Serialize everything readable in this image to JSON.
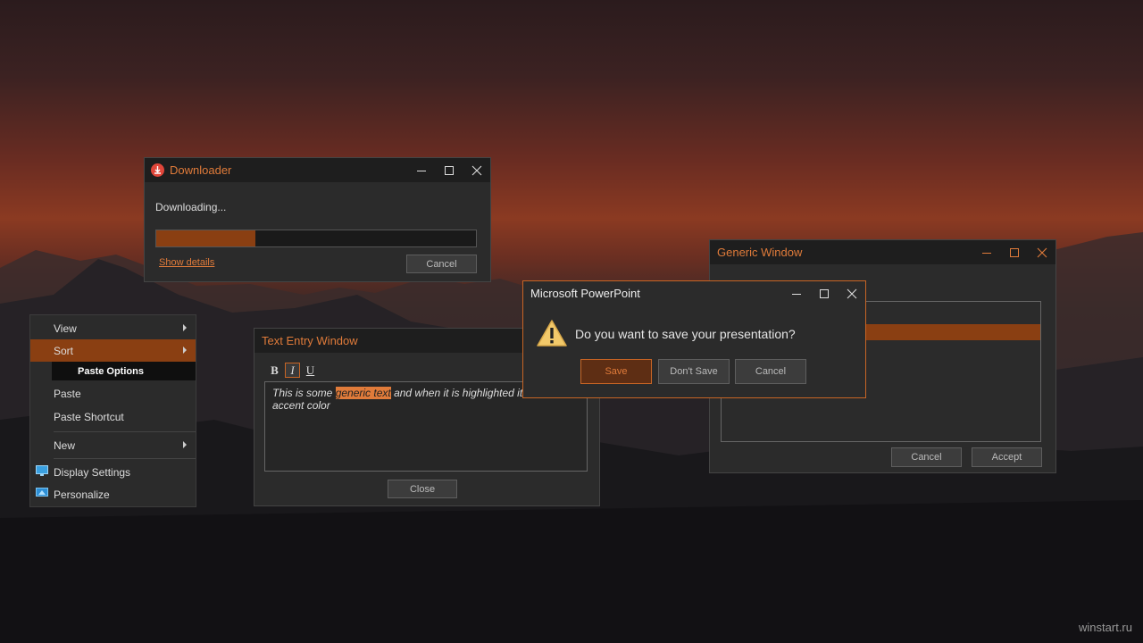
{
  "downloader": {
    "title": "Downloader",
    "status": "Downloading...",
    "progress": 0.31,
    "show_details": "Show details",
    "cancel": "Cancel"
  },
  "context_menu": {
    "view": "View",
    "sort": "Sort",
    "paste_options": "Paste Options",
    "paste": "Paste",
    "paste_shortcut": "Paste Shortcut",
    "new": "New",
    "display_settings": "Display Settings",
    "personalize": "Personalize"
  },
  "text_entry": {
    "title": "Text Entry  Window",
    "bold": "B",
    "italic": "I",
    "underline": "U",
    "text_before": "This is some ",
    "text_highlight": "generic text",
    "text_after": " and when it is highlighted it uses the accent color",
    "close": "Close"
  },
  "generic_window": {
    "title": "Generic Window",
    "cancel": "Cancel",
    "accept": "Accept"
  },
  "powerpoint": {
    "title": "Microsoft  PowerPoint",
    "question": "Do you want to save your presentation?",
    "save": "Save",
    "dont_save": "Don't Save",
    "cancel": "Cancel"
  },
  "watermark": "winstart.ru",
  "colors": {
    "accent": "#e07b3a",
    "accent_dark": "#8a3f12",
    "window_bg": "#2b2b2b",
    "titlebar_bg": "#1e1e1e"
  }
}
